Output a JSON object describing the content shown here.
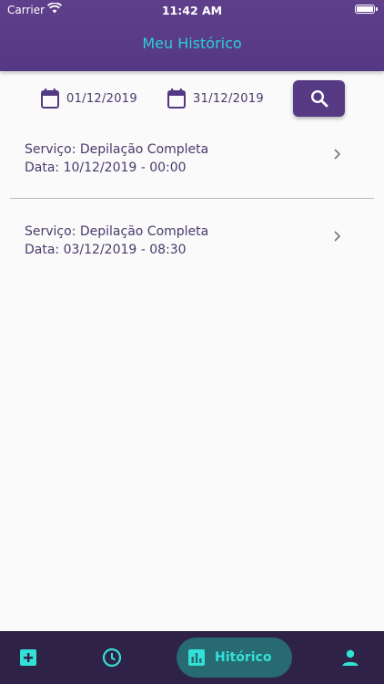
{
  "status_bar": {
    "carrier": "Carrier",
    "time": "11:42 AM"
  },
  "header": {
    "title": "Meu Histórico"
  },
  "filters": {
    "start_date": "01/12/2019",
    "end_date": "31/12/2019",
    "search_icon": "search-icon",
    "calendar_icon": "calendar-icon"
  },
  "history": [
    {
      "service": "Serviço: Depilação Completa",
      "date": "Data: 10/12/2019 - 00:00"
    },
    {
      "service": "Serviço: Depilação Completa",
      "date": "Data: 03/12/2019 - 08:30"
    }
  ],
  "tabbar": {
    "active_label": "Hitórico",
    "icons": [
      "add-box-icon",
      "clock-icon",
      "bar-chart-icon",
      "person-icon"
    ]
  },
  "colors": {
    "primary": "#553883",
    "accent": "#2ad1d0",
    "text": "#4b3a6b",
    "tabbar": "#2e2246",
    "tab_active_bg": "#276a72"
  }
}
